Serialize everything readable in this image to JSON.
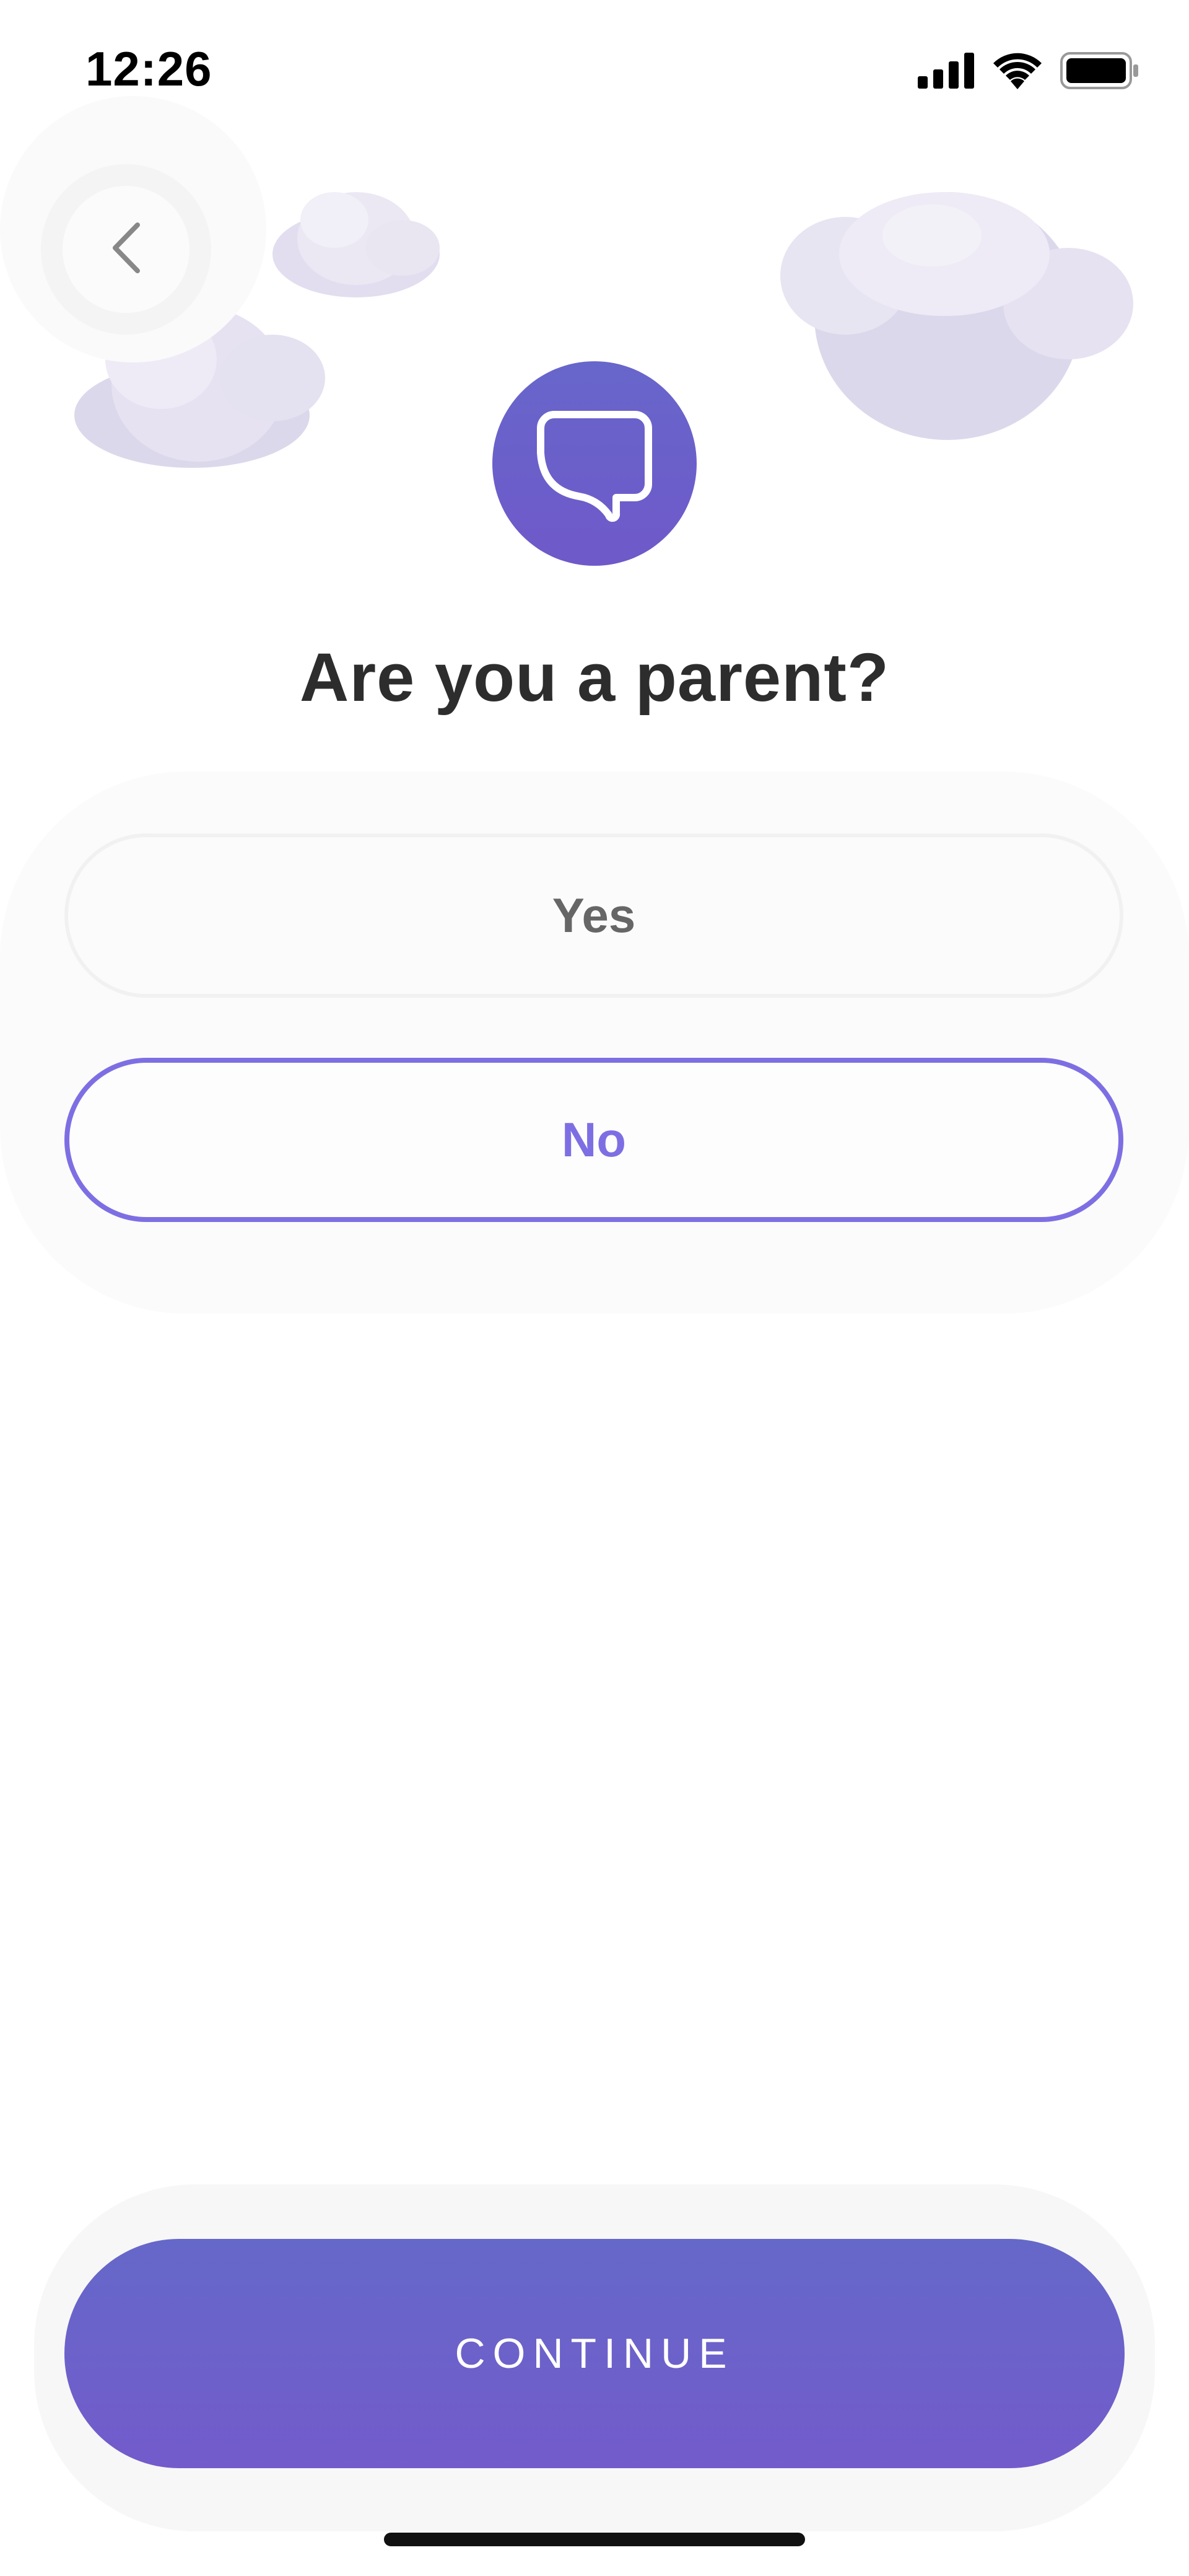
{
  "status_bar": {
    "time": "12:26",
    "icons": [
      "cellular-signal-icon",
      "wifi-icon",
      "battery-icon"
    ]
  },
  "header": {
    "back_icon": "chevron-left-icon",
    "logo_icon": "speech-bubble-icon"
  },
  "question": {
    "text": "Are you a parent?"
  },
  "options": [
    {
      "label": "Yes",
      "selected": false
    },
    {
      "label": "No",
      "selected": true
    }
  ],
  "footer": {
    "continue_label": "CONTINUE"
  },
  "colors": {
    "accent": "#7d6fe3",
    "button_gradient_top": "#6568c9",
    "button_gradient_bottom": "#735bcb",
    "cloud": "#e4e0ef"
  }
}
